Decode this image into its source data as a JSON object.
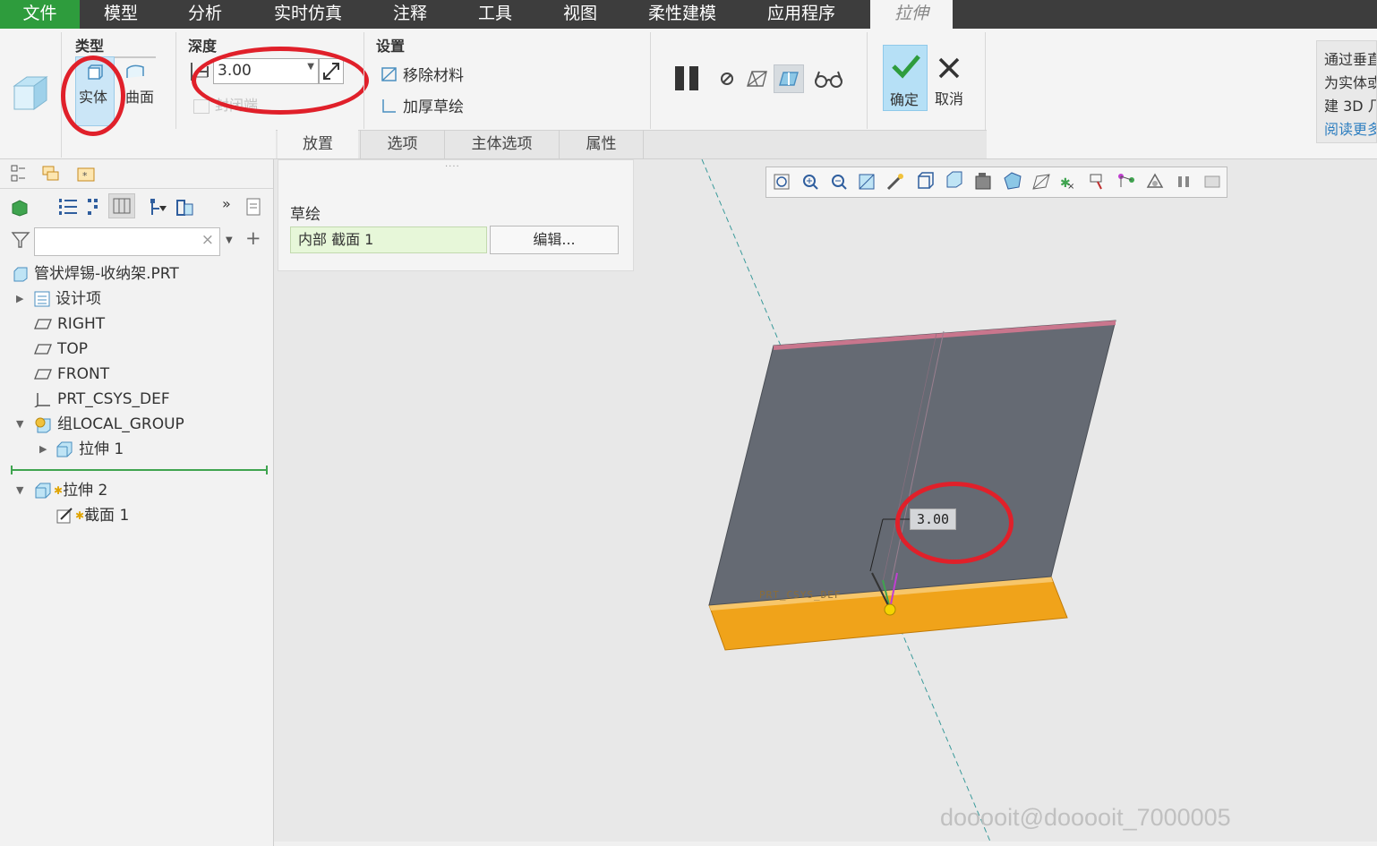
{
  "menubar": {
    "tabs": [
      "文件",
      "模型",
      "分析",
      "实时仿真",
      "注释",
      "工具",
      "视图",
      "柔性建模",
      "应用程序"
    ],
    "active_tab": "拉伸"
  },
  "ribbon": {
    "type_group": {
      "label": "类型",
      "solid": "实体",
      "surface": "曲面"
    },
    "depth_group": {
      "label": "深度",
      "value": "3.00",
      "capped_ends": "封闭端"
    },
    "settings_group": {
      "label": "设置",
      "remove_material": "移除材料",
      "thicken_sketch": "加厚草绘"
    },
    "ok_label": "确定",
    "cancel_label": "取消",
    "bottom_tabs": [
      "放置",
      "选项",
      "主体选项",
      "属性"
    ]
  },
  "help": {
    "lines": [
      "通过垂直",
      "为实体或",
      "建 3D 几"
    ],
    "link": "阅读更多"
  },
  "placement": {
    "sketch_label": "草绘",
    "section_value": "内部 截面 1",
    "edit_button": "编辑..."
  },
  "model_tree": {
    "search_placeholder": "",
    "items": [
      {
        "label": "管状焊锡-收纳架.PRT"
      },
      {
        "label": "设计项"
      },
      {
        "label": "RIGHT"
      },
      {
        "label": "TOP"
      },
      {
        "label": "FRONT"
      },
      {
        "label": "PRT_CSYS_DEF"
      },
      {
        "label": "组LOCAL_GROUP"
      },
      {
        "label": "拉伸 1"
      },
      {
        "label": "拉伸 2"
      },
      {
        "label": "截面 1"
      }
    ]
  },
  "viewport": {
    "dimension_value": "3.00",
    "csys_label": "PRT_CSYS_DEF",
    "watermark": "dooooit@dooooit_7000005"
  },
  "colors": {
    "menubar_bg": "#3d3d3d",
    "file_tab": "#2e9c3d",
    "plate": "#656a73",
    "base": "#f0a31a",
    "annotation": "#e0202a",
    "selected_bg": "#cbe6f7"
  }
}
